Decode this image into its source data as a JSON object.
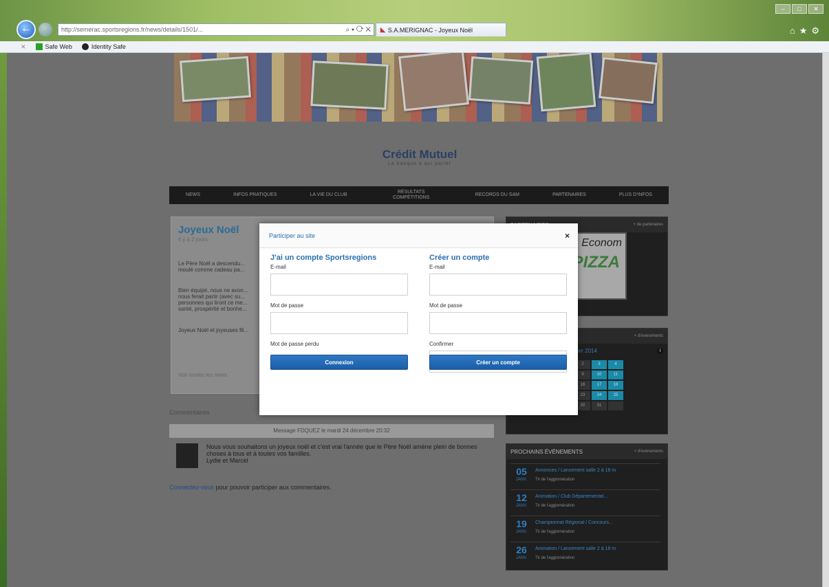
{
  "browser": {
    "url": "http://semerac.sportsregions.fr/news/details/1501/...",
    "tab_title": "S.A.MERIGNAC - Joyeux Noël",
    "favorites": [
      "Safe Web",
      "Identity Safe"
    ]
  },
  "site": {
    "sponsor_name": "Crédit Mutuel",
    "sponsor_slogan": "La banque à qui parler",
    "menu": [
      "News",
      "Infos pratiques",
      "La vie du club",
      "Résultats compétitions",
      "Records du SAM",
      "Partenaires",
      "Plus d'infos"
    ]
  },
  "article": {
    "title": "Joyeux Noël",
    "date": "Il y a 2 jours",
    "paragraphs": [
      "Le Père Noël a descendu... moulé comme cadeau pa...",
      "Bien équipé, nous ne avon... nous ferait partir (avec su... personnes qui liront ce me... santé, prospérité et bonhe...",
      "Joyeux Noël et joyeuses fê..."
    ],
    "share": "Voir toutes les news"
  },
  "comments": {
    "title": "Commentaires",
    "head": "Message FDQUEZ le mardi 24 décembre 20:32",
    "text": "Nous vous souhaitons un joyeux noël et c'est vrai l'année que le Père Noël amène plein de bonnes choses à tous et à toutes vos familles.",
    "sign": "Lydie et Marcel",
    "connect_link": "Connectez-vous",
    "connect_rest": "pour pouvoir participer aux commentaires."
  },
  "sidebar": {
    "partners_title": "Partenaires",
    "partners_link": "+ de partenaires",
    "pizza_a": "Econom",
    "pizza_b": "PIZZA",
    "calendar_link": "+ d'événements",
    "calendar_month": "Janvier 2014",
    "calendar_days": [
      "",
      "",
      "",
      "1",
      "2",
      "3",
      "4",
      "5",
      "6",
      "7",
      "8",
      "9",
      "10",
      "11",
      "12",
      "13",
      "14",
      "15",
      "16",
      "17",
      "18",
      "19",
      "20",
      "21",
      "22",
      "23",
      "24",
      "25",
      "26",
      "27",
      "28",
      "29",
      "30",
      "31",
      ""
    ],
    "events_title": "Prochains événements",
    "events_link": "+ d'événements",
    "events": [
      {
        "day": "05",
        "month": "JANV.",
        "title": "Annonces / Lancement salle 2 à 18 m",
        "sub": "Tir de l'agglomération"
      },
      {
        "day": "12",
        "month": "JANV.",
        "title": "Animation / Club Départemental...",
        "sub": "Tir de l'agglomération"
      },
      {
        "day": "19",
        "month": "JANV.",
        "title": "Championnat Régional / Concours...",
        "sub": "Tir de l'agglomération"
      },
      {
        "day": "26",
        "month": "JANV.",
        "title": "Animation / Lancement salle 2 à 18 m",
        "sub": "Tir de l'agglomération"
      }
    ]
  },
  "modal": {
    "title": "Participer au site",
    "close": "×",
    "login": {
      "heading": "J'ai un compte Sportsregions",
      "email_label": "E-mail",
      "password_label": "Mot de passe",
      "lost_password": "Mot de passe perdu",
      "submit": "Connexion"
    },
    "signup": {
      "heading": "Créer un compte",
      "email_label": "E-mail",
      "password_label": "Mot de passe",
      "confirm_label": "Confirmer",
      "submit": "Créer un compte"
    }
  }
}
